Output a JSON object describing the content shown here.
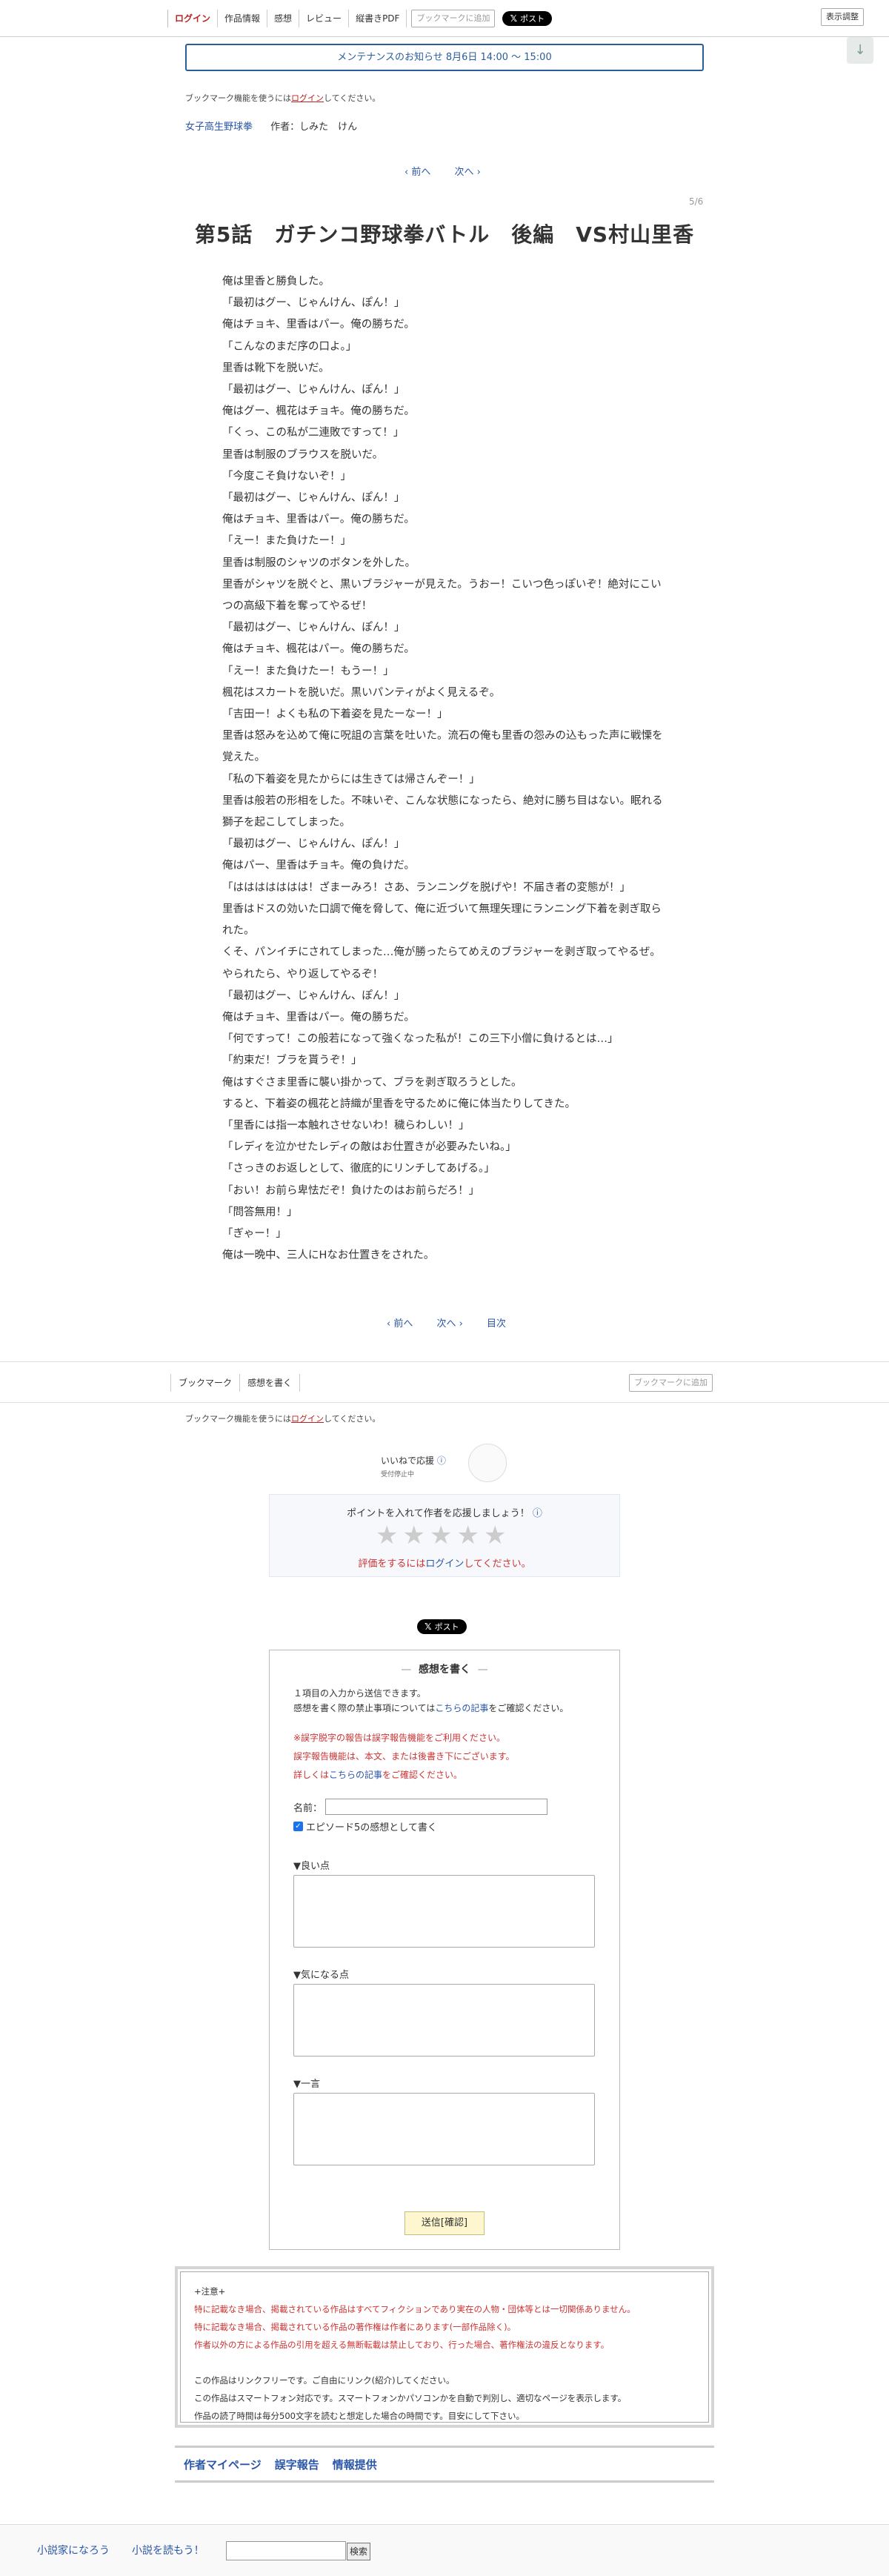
{
  "header": {
    "nav": [
      "ログイン",
      "作品情報",
      "感想",
      "レビュー",
      "縦書きPDF"
    ],
    "bookmark_btn": "ブックマークに追加",
    "x_post": "ポスト",
    "display_settings": "表示調整"
  },
  "maintenance": "メンテナンスのお知らせ 8月6日 14:00 〜 15:00",
  "bookmark_note": {
    "prefix": "ブックマーク機能を使うには",
    "login": "ログイン",
    "suffix": "してください。"
  },
  "series": {
    "title": "女子高生野球拳",
    "author_label": "作者：",
    "author": "しみた　けん"
  },
  "pager_top": {
    "prev": "前へ",
    "next": "次へ"
  },
  "page_count": "5/6",
  "episode_title": "第5話　ガチンコ野球拳バトル　後編　VS村山里香",
  "body": [
    "俺は里香と勝負した。",
    "「最初はグー、じゃんけん、ぽん！」",
    "俺はチョキ、里香はパー。俺の勝ちだ。",
    "「こんなのまだ序の口よ。」",
    "里香は靴下を脱いだ。",
    "「最初はグー、じゃんけん、ぽん！」",
    "俺はグー、楓花はチョキ。俺の勝ちだ。",
    "「くっ、この私が二連敗ですって！」",
    "里香は制服のブラウスを脱いだ。",
    "「今度こそ負けないぞ！」",
    "「最初はグー、じゃんけん、ぽん！」",
    "俺はチョキ、里香はパー。俺の勝ちだ。",
    "「えー！また負けたー！」",
    "里香は制服のシャツのボタンを外した。",
    "里香がシャツを脱ぐと、黒いブラジャーが見えた。うおー！こいつ色っぽいぞ！絶対にこいつの高級下着を奪ってやるぜ！",
    "「最初はグー、じゃんけん、ぽん！」",
    "俺はチョキ、楓花はパー。俺の勝ちだ。",
    "「えー！また負けたー！もうー！」",
    "楓花はスカートを脱いだ。黒いパンティがよく見えるぞ。",
    "「吉田ー！よくも私の下着姿を見たーなー！」",
    "里香は怒みを込めて俺に呪詛の言葉を吐いた。流石の俺も里香の怨みの込もった声に戦慄を覚えた。",
    "「私の下着姿を見たからには生きては帰さんぞー！」",
    "里香は般若の形相をした。不味いぞ、こんな状態になったら、絶対に勝ち目はない。眠れる獅子を起こしてしまった。",
    "「最初はグー、じゃんけん、ぽん！」",
    "俺はパー、里香はチョキ。俺の負けだ。",
    "「ははははははは！ざまーみろ！さあ、ランニングを脱げや！不届き者の変態が！」",
    "里香はドスの効いた口調で俺を脅して、俺に近づいて無理矢理にランニング下着を剥ぎ取られた。",
    "くそ、パンイチにされてしまった…俺が勝ったらてめえのブラジャーを剥ぎ取ってやるぜ。やられたら、やり返してやるぞ！",
    "「最初はグー、じゃんけん、ぽん！」",
    "俺はチョキ、里香はパー。俺の勝ちだ。",
    "「何ですって！この般若になって強くなった私が！この三下小僧に負けるとは…」",
    "「約束だ！ブラを貰うぞ！」",
    "俺はすぐさま里香に襲い掛かって、ブラを剥ぎ取ろうとした。",
    "すると、下着姿の楓花と詩織が里香を守るために俺に体当たりしてきた。",
    "「里香には指一本触れさせないわ！穢らわしい！」",
    "「レディを泣かせたレディの敵はお仕置きが必要みたいね。」",
    "「さっきのお返しとして、徹底的にリンチしてあげる。」",
    "「おい！お前ら卑怯だぞ！負けたのはお前らだろ！」",
    "「問答無用！」",
    "「ぎゃー！」",
    "俺は一晩中、三人にHなお仕置きをされた。"
  ],
  "pager_bottom": {
    "prev": "前へ",
    "next": "次へ",
    "toc": "目次"
  },
  "subnav": {
    "tabs": [
      "ブックマーク",
      "感想を書く"
    ],
    "bookmark_btn": "ブックマークに追加"
  },
  "good": {
    "label": "いいねで応援",
    "status": "受付停止中"
  },
  "points": {
    "heading": "ポイントを入れて作者を応援しましょう！",
    "stars": 5,
    "login_prefix": "評価をするには",
    "login": "ログイン",
    "login_suffix": "してください。"
  },
  "x_post_2": "ポスト",
  "review": {
    "title": "感想を書く",
    "note1": "１項目の入力から送信できます。",
    "note2_prefix": "感想を書く際の禁止事項については",
    "note2_link": "こちらの記事",
    "note2_suffix": "をご確認ください。",
    "warn1": "※誤字脱字の報告は誤字報告機能をご利用ください。",
    "warn2": "誤字報告機能は、本文、または後書き下にございます。",
    "warn3_prefix": "詳しくは",
    "warn3_link": "こちらの記事",
    "warn3_suffix": "をご確認ください。",
    "name_label": "名前：",
    "episode_check": "エピソード5の感想として書く",
    "good_label": "▼良い点",
    "concern_label": "▼気になる点",
    "comment_label": "▼一言",
    "submit": "送信[確認]"
  },
  "notice": {
    "heading": "+注意+",
    "line1": "特に記載なき場合、掲載されている作品はすべてフィクションであり実在の人物・団体等とは一切関係ありません。",
    "line2": "特に記載なき場合、掲載されている作品の著作権は作者にあります(一部作品除く)。",
    "line3": "作者以外の方による作品の引用を超える無断転載は禁止しており、行った場合、著作権法の違反となります。",
    "line4": "この作品はリンクフリーです。ご自由にリンク(紹介)してください。",
    "line5": "この作品はスマートフォン対応です。スマートフォンかパソコンかを自動で判別し、適切なページを表示します。",
    "line6": "作品の読了時間は毎分500文字を読むと想定した場合の時間です。目安にして下さい。"
  },
  "author_links": [
    "作者マイページ",
    "誤字報告",
    "情報提供"
  ],
  "footer": {
    "links": [
      "小説家になろう",
      "小説を読もう！"
    ],
    "search": "検索"
  }
}
